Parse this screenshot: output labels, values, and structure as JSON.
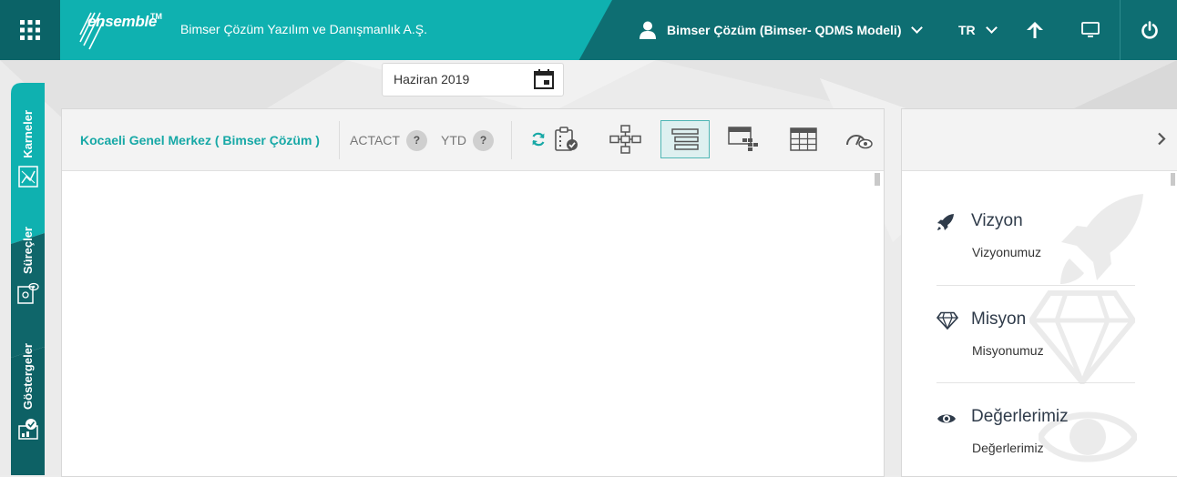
{
  "header": {
    "app_name": "ensemble",
    "trademark": "TM",
    "company": "Bimser Çözüm Yazılım ve Danışmanlık A.Ş.",
    "user": "Bimser Çözüm (Bimser- QDMS Modeli)",
    "language": "TR"
  },
  "sidebar": {
    "tabs": [
      {
        "label": "Karneler",
        "icon": "scorecard-icon"
      },
      {
        "label": "Süreçler",
        "icon": "process-icon"
      },
      {
        "label": "Göstergeler",
        "icon": "indicator-icon"
      }
    ]
  },
  "date_picker": {
    "value": "Haziran 2019"
  },
  "main": {
    "org_name": "Kocaeli Genel Merkez ( Bimser Çözüm )",
    "metric1": "ACTACT",
    "metric2": "YTD",
    "help_symbol": "?"
  },
  "right_panel": {
    "items": [
      {
        "title": "Vizyon",
        "subtitle": "Vizyonumuz",
        "icon": "rocket-icon"
      },
      {
        "title": "Misyon",
        "subtitle": "Misyonumuz",
        "icon": "diamond-icon"
      },
      {
        "title": "Değerlerimiz",
        "subtitle": "Değerlerimiz",
        "icon": "eye-icon"
      }
    ]
  },
  "colors": {
    "accent": "#0fb1b0",
    "topbar": "#0e6e72",
    "sidebar": "#115e62"
  }
}
